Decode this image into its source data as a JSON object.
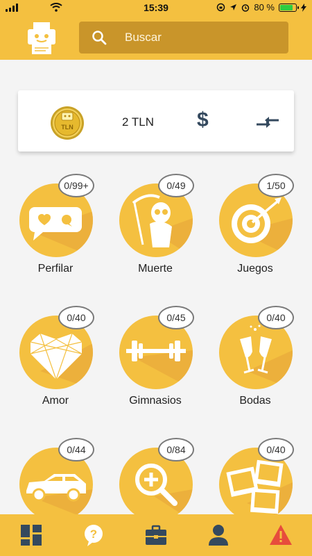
{
  "status": {
    "time": "15:39",
    "battery": "80 %",
    "battery_level": 0.8
  },
  "search": {
    "placeholder": "Buscar"
  },
  "wallet": {
    "balance": "2 TLN",
    "currency_symbol": "$",
    "coin_text": "TLN"
  },
  "categories": [
    {
      "label": "Perfilar",
      "count": "0/99+",
      "icon": "chat-bubble-heart-icon"
    },
    {
      "label": "Muerte",
      "count": "0/49",
      "icon": "grim-reaper-icon"
    },
    {
      "label": "Juegos",
      "count": "1/50",
      "icon": "target-arrow-icon"
    },
    {
      "label": "Amor",
      "count": "0/40",
      "icon": "geometric-heart-icon"
    },
    {
      "label": "Gimnasios",
      "count": "0/45",
      "icon": "barbell-icon"
    },
    {
      "label": "Bodas",
      "count": "0/40",
      "icon": "champagne-glasses-icon"
    },
    {
      "label": "",
      "count": "0/44",
      "icon": "car-icon"
    },
    {
      "label": "",
      "count": "0/84",
      "icon": "zoom-plus-icon"
    },
    {
      "label": "",
      "count": "0/40",
      "icon": "photos-icon"
    }
  ],
  "nav": [
    {
      "icon": "dashboard-icon"
    },
    {
      "icon": "help-bubble-icon"
    },
    {
      "icon": "briefcase-icon"
    },
    {
      "icon": "user-icon"
    },
    {
      "icon": "warning-icon"
    }
  ],
  "colors": {
    "brand": "#f4c040",
    "search_bg": "#c9952a",
    "warning": "#e74c3c"
  }
}
